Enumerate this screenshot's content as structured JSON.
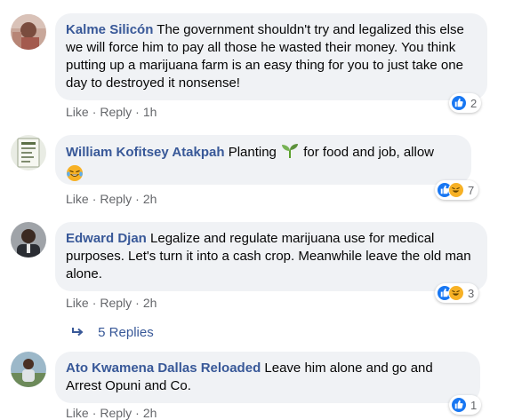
{
  "comments": [
    {
      "author": "Kalme Silicón",
      "text": "The government shouldn't try and legalized this else we will force him to pay all those he wasted their money. You think putting up a marijuana farm is an easy thing for you to just take one day to destroyed it nonsense!",
      "like": "Like",
      "reply": "Reply",
      "time": "1h",
      "reaction_count": "2"
    },
    {
      "author": "William Kofitsey Atakpah",
      "text_before": "Planting",
      "text_after": "for food and job, allow",
      "like": "Like",
      "reply": "Reply",
      "time": "2h",
      "reaction_count": "7"
    },
    {
      "author": "Edward Djan",
      "text": "Legalize and regulate marijuana use for medical purposes. Let's turn it into a cash crop. Meanwhile leave the old man alone.",
      "like": "Like",
      "reply": "Reply",
      "time": "2h",
      "reaction_count": "3",
      "replies_label": "5 Replies"
    },
    {
      "author": "Ato Kwamena Dallas Reloaded",
      "text": "Leave him alone and go and Arrest Opuni and Co.",
      "like": "Like",
      "reply": "Reply",
      "time": "2h",
      "reaction_count": "1"
    }
  ],
  "separator": "·",
  "colors": {
    "author": "#385898",
    "bubble": "#f0f2f5",
    "meta": "#65676b",
    "like_reaction": "#1877f2",
    "haha_reaction": "#f7b125"
  },
  "icons": {
    "like_reaction": "thumbs-up-icon",
    "haha_reaction": "laughing-face-icon",
    "seedling": "seedling-icon",
    "laughing": "laughing-tears-icon",
    "reply_arrow": "reply-arrow-icon"
  }
}
